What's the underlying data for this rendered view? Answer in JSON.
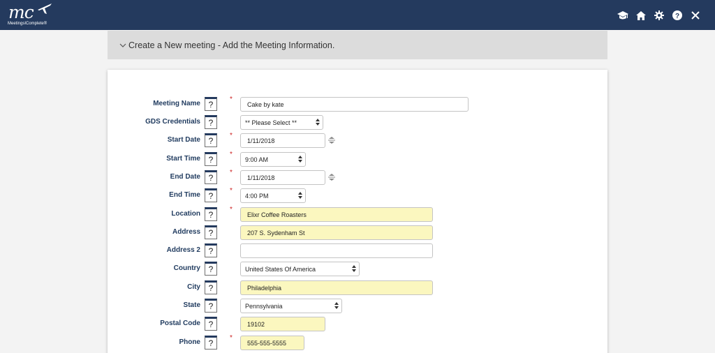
{
  "app": {
    "logo_text": "mc",
    "logo_subtitle": "MeetingsIComplete®",
    "icons": [
      "graduation-cap-icon",
      "home-icon",
      "gear-icon",
      "help-icon",
      "close-icon"
    ]
  },
  "section": {
    "title": "Create a New meeting - Add the Meeting Information."
  },
  "help_glyph": "?",
  "required_mark": "*",
  "form": {
    "meeting_name": {
      "label": "Meeting Name",
      "value": "Cake by kate"
    },
    "gds_credentials": {
      "label": "GDS Credentials",
      "value": "** Please Select **"
    },
    "start_date": {
      "label": "Start Date",
      "value": "1/11/2018"
    },
    "start_time": {
      "label": "Start Time",
      "value": "9:00 AM"
    },
    "end_date": {
      "label": "End Date",
      "value": "1/11/2018"
    },
    "end_time": {
      "label": "End Time",
      "value": "4:00 PM"
    },
    "location": {
      "label": "Location",
      "value": "Elixr Coffee Roasters"
    },
    "address": {
      "label": "Address",
      "value": "207 S. Sydenham St"
    },
    "address2": {
      "label": "Address 2",
      "value": ""
    },
    "country": {
      "label": "Country",
      "value": "United States Of America"
    },
    "city": {
      "label": "City",
      "value": "Philadelphia"
    },
    "state": {
      "label": "State",
      "value": "Pennsylvania"
    },
    "postal_code": {
      "label": "Postal Code",
      "value": "19102"
    },
    "phone": {
      "label": "Phone",
      "value": "555-555-5555"
    }
  },
  "colors": {
    "topbar": "#243a5e",
    "label": "#1f3a5e",
    "required": "#cc2222",
    "prefilled_field": "#fbf7bf"
  }
}
